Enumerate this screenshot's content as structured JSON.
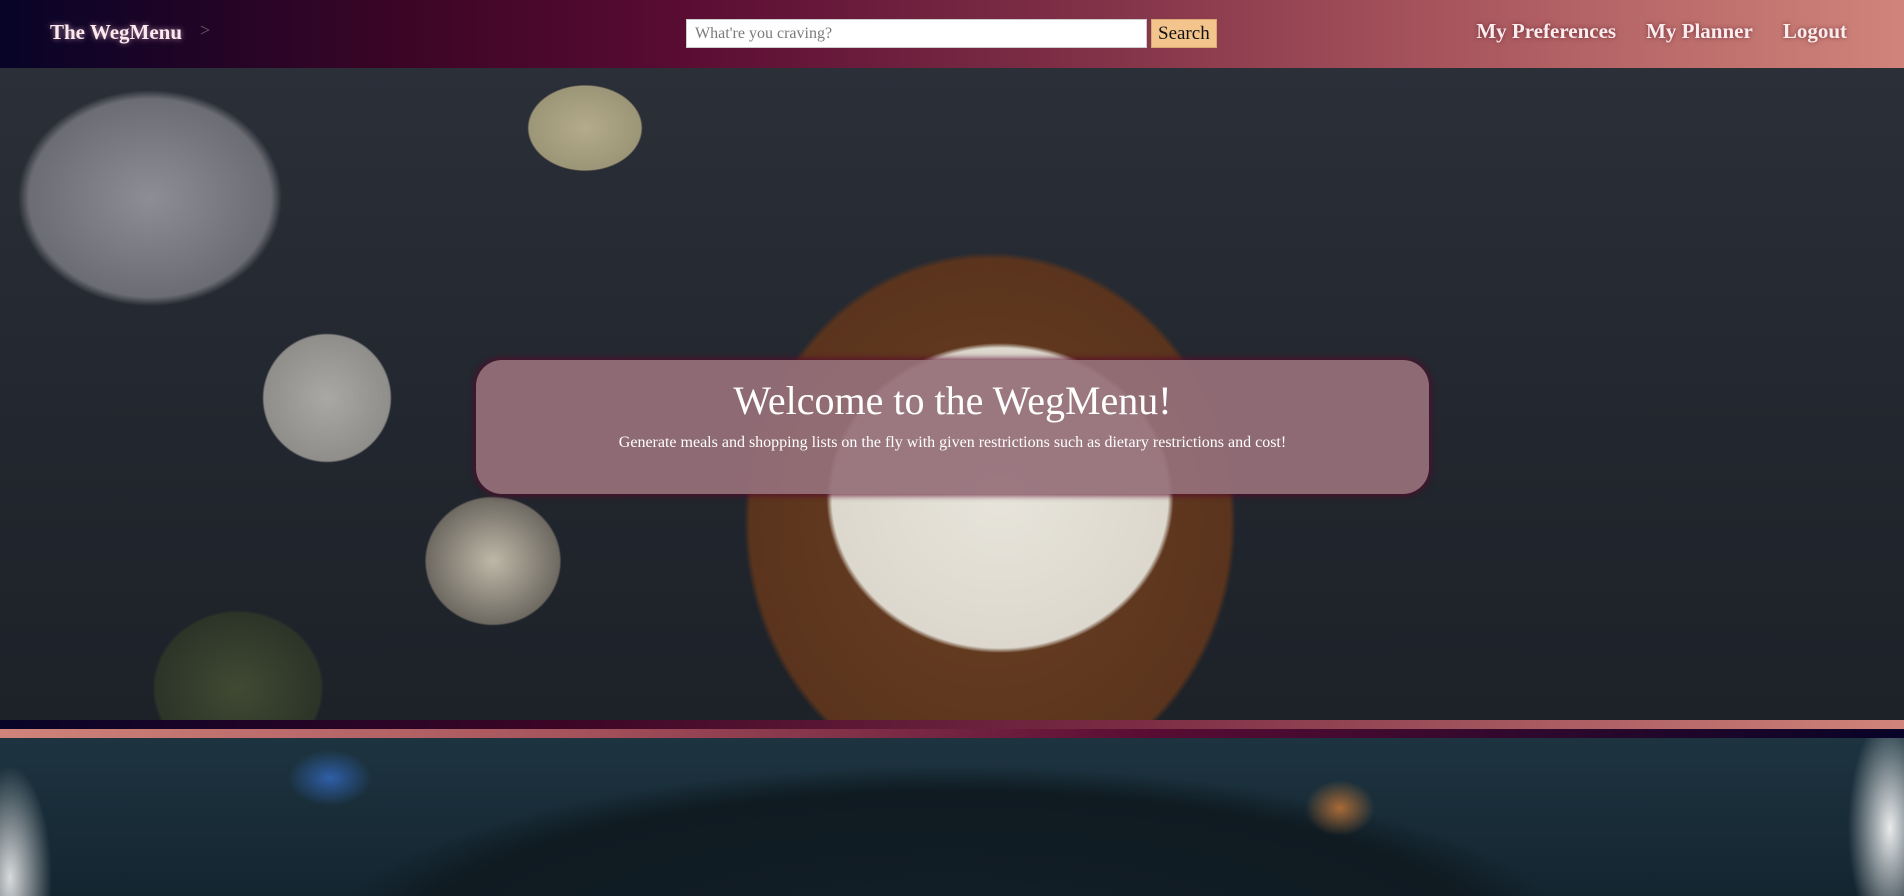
{
  "navbar": {
    "brand": "The WegMenu",
    "toggler": ">",
    "search": {
      "placeholder": "What're you craving?",
      "value": "",
      "button_label": "Search"
    },
    "links": [
      {
        "label": "My Preferences"
      },
      {
        "label": "My Planner"
      },
      {
        "label": "Logout"
      }
    ]
  },
  "hero": {
    "title": "Welcome to the WegMenu!",
    "subtitle": "Generate meals and shopping lists on the fly with given restrictions such as dietary restrictions and cost!"
  },
  "colors": {
    "navbar_gradient_start": "#070427",
    "navbar_gradient_mid": "#5a0c33",
    "navbar_gradient_end": "#d0847a",
    "search_button": "#f3c58d",
    "hero_card": "#96707a"
  }
}
